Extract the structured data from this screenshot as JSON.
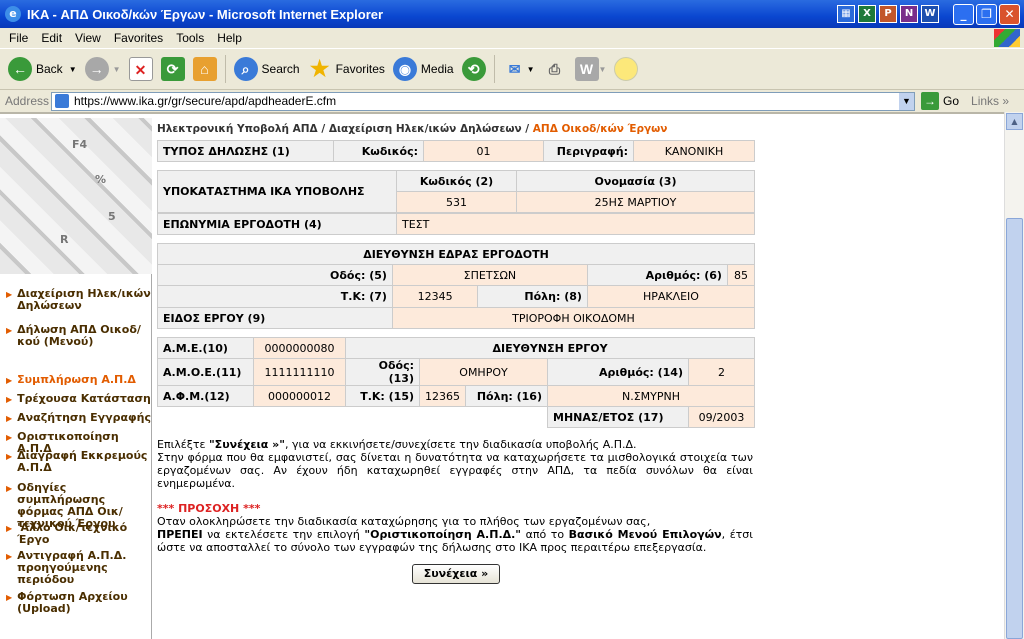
{
  "window": {
    "title": "IKA - ΑΠΔ Οικοδ/κών Έργων - Microsoft Internet Explorer"
  },
  "menu": [
    "File",
    "Edit",
    "View",
    "Favorites",
    "Tools",
    "Help"
  ],
  "toolbar": {
    "back": "Back",
    "search": "Search",
    "favorites": "Favorites",
    "media": "Media"
  },
  "address": {
    "label": "Address",
    "url": "https://www.ika.gr/gr/secure/apd/apdheaderE.cfm",
    "go": "Go",
    "links": "Links"
  },
  "sidebar": {
    "items": [
      {
        "label": "Διαχείριση Ηλεκ/ικών Δηλώσεων",
        "active": false
      },
      {
        "label": "Δήλωση ΑΠΔ Οικοδ/κού (Μενού)",
        "active": false
      },
      {
        "label": "Συμπλήρωση Α.Π.Δ",
        "active": true
      },
      {
        "label": "Τρέχουσα Κατάσταση",
        "active": false
      },
      {
        "label": "Αναζήτηση Εγγραφής",
        "active": false
      },
      {
        "label": "Οριστικοποίηση Α.Π.Δ",
        "active": false
      },
      {
        "label": "Διαγραφή Εκκρεμούς Α.Π.Δ",
        "active": false
      },
      {
        "label": "Οδηγίες συμπλήρωσης φόρμας ΑΠΔ Οικ/τεχνικού Έργου",
        "active": false
      },
      {
        "label": "'Αλλο Οικ/τεχνικό Έργο",
        "active": false
      },
      {
        "label": "Αντιγραφή Α.Π.Δ. προηγούμενης περιόδου",
        "active": false
      },
      {
        "label": "Φόρτωση Αρχείου (Upload)",
        "active": false
      }
    ]
  },
  "breadcrumb": {
    "part1": "Ηλεκτρονική Υποβολή ΑΠΔ",
    "part2": "Διαχείριση Ηλεκ/ικών Δηλώσεων",
    "current": "ΑΠΔ Οικοδ/κών Έργων",
    "sep": " / "
  },
  "decl_type": {
    "label": "ΤΥΠΟΣ ΔΗΛΩΣΗΣ (1)",
    "code_label": "Κωδικός:",
    "code": "01",
    "desc_label": "Περιγραφή:",
    "desc": "ΚΑΝΟΝΙΚΗ"
  },
  "branch": {
    "label": "ΥΠΟΚΑΤΑΣΤΗΜΑ ΙΚΑ ΥΠΟΒΟΛΗΣ",
    "code_label": "Κωδικός (2)",
    "name_label": "Ονομασία (3)",
    "code": "531",
    "name": "25ΗΣ ΜΑΡΤΙΟΥ"
  },
  "employer": {
    "label": "ΕΠΩΝΥΜΙΑ ΕΡΓΟΔΟΤΗ (4)",
    "value": "ΤΕΣΤ"
  },
  "employer_address": {
    "title": "ΔΙΕΥΘΥΝΣΗ ΕΔΡΑΣ ΕΡΓΟΔΟΤΗ",
    "street_label": "Οδός: (5)",
    "street": "ΣΠΕΤΣΩΝ",
    "number_label": "Αριθμός: (6)",
    "number": "85",
    "zip_label": "Τ.Κ: (7)",
    "zip": "12345",
    "city_label": "Πόλη: (8)",
    "city": "ΗΡΑΚΛΕΙΟ",
    "work_type_label": "ΕΙΔΟΣ ΕΡΓΟΥ (9)",
    "work_type": "ΤΡΙΟΡΟΦΗ ΟΙΚΟΔΟΜΗ"
  },
  "project": {
    "ame_label": "Α.Μ.Ε.(10)",
    "ame": "0000000080",
    "addr_title": "ΔΙΕΥΘΥΝΣΗ ΕΡΓΟΥ",
    "amoe_label": "Α.Μ.Ο.Ε.(11)",
    "amoe": "1111111110",
    "street_label": "Οδός: (13)",
    "street": "ΟΜΗΡΟΥ",
    "number_label": "Αριθμός: (14)",
    "number": "2",
    "afm_label": "Α.Φ.Μ.(12)",
    "afm": "000000012",
    "zip_label": "Τ.Κ: (15)",
    "zip": "12365",
    "city_label": "Πόλη: (16)",
    "city": "Ν.ΣΜΥΡΝΗ",
    "period_label": "ΜΗΝΑΣ/ΕΤΟΣ (17)",
    "period": "09/2003"
  },
  "instructions": {
    "p1_a": "Επιλέξτε ",
    "p1_b": "\"Συνέχεια »\"",
    "p1_c": ", για να εκκινήσετε/συνεχίσετε την διαδικασία υποβολής Α.Π.Δ.",
    "p2": "Στην φόρμα που θα εμφανιστεί, σας δίνεται η δυνατότητα να καταχωρήσετε τα μισθολογικά στοιχεία των εργαζομένων σας. Αν έχουν ήδη καταχωρηθεί εγγραφές στην ΑΠΔ, τα πεδία συνόλων θα είναι ενημερωμένα.",
    "warn": "*** ΠΡΟΣΟΧΗ ***",
    "p3": "Οταν ολοκληρώσετε την διαδικασία καταχώρησης για το πλήθος των εργαζομένων σας,",
    "p4_a": "ΠΡΕΠΕΙ",
    "p4_b": " να εκτελέσετε την επιλογή ",
    "p4_c": "\"Οριστικοποίηση Α.Π.Δ.\"",
    "p4_d": " από το ",
    "p4_e": "Βασικό Μενού Επιλογών",
    "p4_f": ", έτσι ώστε να αποσταλλεί το σύνολο των εγγραφών της δήλωσης στο ΙΚΑ προς περαιτέρω επεξεργασία."
  },
  "continue_button": "Συνέχεια »"
}
